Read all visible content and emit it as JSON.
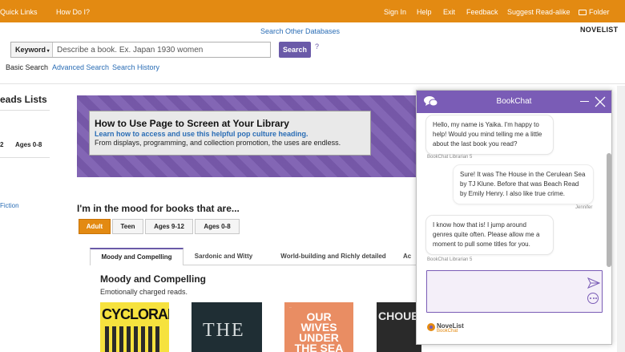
{
  "topbar": {
    "quick_links": "Quick Links",
    "how_do_i": "How Do I?",
    "sign_in": "Sign In",
    "help": "Help",
    "exit": "Exit",
    "feedback": "Feedback",
    "suggest": "Suggest Read-alike",
    "folder": "Folder"
  },
  "header": {
    "search_other": "Search Other Databases",
    "brand": "NOVELIST",
    "search_type": "Keyword",
    "search_placeholder": "Describe a book. Ex. Japan 1930 women",
    "search_button": "Search",
    "help_mark": "?",
    "basic_search": "Basic Search",
    "advanced_search": "Advanced Search",
    "search_history": "Search History"
  },
  "left": {
    "title": "eads Lists",
    "number": "2",
    "ages": "Ages 0-8",
    "fiction": "Fiction"
  },
  "banner": {
    "title": "How to Use Page to Screen at Your Library",
    "link": "Learn how to access and use this helpful pop culture heading.",
    "text": "From displays, programming, and collection promotion, the uses are endless."
  },
  "mood": {
    "heading": "I'm in the mood for books that are...",
    "pills": [
      "Adult",
      "Teen",
      "Ages 9-12",
      "Ages 0-8"
    ],
    "subtabs": [
      "Moody and Compelling",
      "Sardonic and Witty",
      "World-building and Richly detailed",
      "Ac"
    ],
    "section_title": "Moody and Compelling",
    "section_sub": "Emotionally charged reads."
  },
  "covers": {
    "c1": "CYCLORAMA",
    "c2": "THE",
    "c3_small": "...",
    "c3": "OUR WIVES UNDER THE SEA",
    "c4": "CHOUE"
  },
  "chat": {
    "title": "BookChat",
    "messages": [
      {
        "text": "Hello, my name is Yaika. I'm happy to help! Would you mind telling me a little about the last book you read?",
        "sender": "BookChat Librarian 5"
      },
      {
        "text": "Sure! It was The House in the Cerulean Sea by TJ Klune. Before that was Beach Read by Emily Henry. I also like true crime.",
        "sender": "Jennifer"
      },
      {
        "text": "I know how that is! I jump around genres quite often. Please allow me a moment to pull some titles for you.",
        "sender": "BookChat Librarian 5"
      }
    ],
    "footer_brand": "NoveList",
    "footer_sub": "BookChat"
  },
  "colors": {
    "topbar": "#e38a12",
    "accent_purple": "#7a5cb6",
    "link_blue": "#2a6db5"
  }
}
